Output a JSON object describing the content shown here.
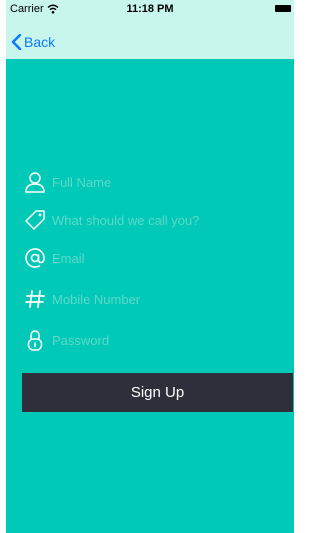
{
  "status_bar": {
    "carrier": "Carrier",
    "time": "11:18 PM"
  },
  "nav": {
    "back_label": "Back"
  },
  "form": {
    "full_name_placeholder": "Full Name",
    "nickname_placeholder": "What should we call you?",
    "email_placeholder": "Email",
    "mobile_placeholder": "Mobile Number",
    "password_placeholder": "Password",
    "signup_label": "Sign Up"
  },
  "colors": {
    "background": "#00c9b7",
    "top_bar": "#c8f5ec",
    "button": "#2e2f3b",
    "icon": "#ffffff",
    "placeholder": "#5ed8cb",
    "back_tint": "#0a7aff"
  },
  "icons": {
    "full_name": "person-icon",
    "nickname": "tag-icon",
    "email": "at-icon",
    "mobile": "hash-icon",
    "password": "lock-icon"
  }
}
